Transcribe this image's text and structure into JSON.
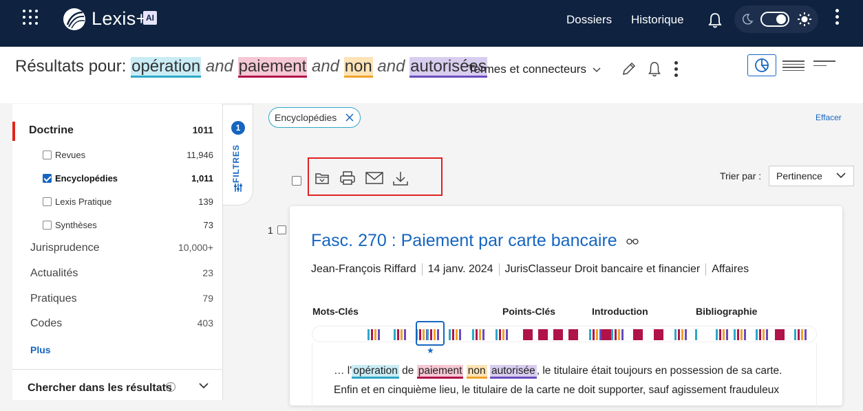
{
  "app": {
    "brand": "Lexis+",
    "ai_badge": "AI"
  },
  "topnav": {
    "dossiers": "Dossiers",
    "historique": "Historique"
  },
  "search": {
    "results_label": "Résultats pour:",
    "terms": [
      "opération",
      "paiement",
      "non",
      "autorisées"
    ],
    "connector": "and",
    "mode": "Termes et connecteurs"
  },
  "sidebar": {
    "categories": [
      {
        "label": "Doctrine",
        "count": "1011",
        "active": true
      },
      {
        "label": "Jurisprudence",
        "count": "10,000+"
      },
      {
        "label": "Actualités",
        "count": "23"
      },
      {
        "label": "Pratiques",
        "count": "79"
      },
      {
        "label": "Codes",
        "count": "403"
      }
    ],
    "subcategories": [
      {
        "label": "Revues",
        "count": "11,946",
        "checked": false
      },
      {
        "label": "Encyclopédies",
        "count": "1,011",
        "checked": true
      },
      {
        "label": "Lexis Pratique",
        "count": "139",
        "checked": false
      },
      {
        "label": "Synthèses",
        "count": "73",
        "checked": false
      }
    ],
    "more": "Plus",
    "search_within": "Chercher dans les résultats"
  },
  "filters": {
    "count": "1",
    "label": "FILTRES"
  },
  "active_filter": {
    "chip": "Encyclopédies",
    "clear": "Effacer"
  },
  "sort": {
    "label": "Trier par :",
    "value": "Pertinence"
  },
  "result": {
    "number": "1",
    "title": "Fasc. 270 : Paiement par carte bancaire",
    "author": "Jean-François Riffard",
    "date": "14 janv. 2024",
    "source": "JurisClasseur Droit bancaire et financier",
    "category": "Affaires",
    "sections": [
      "Mots-Clés",
      "Points-Clés",
      "Introduction",
      "Bibliographie"
    ],
    "snippet_line1": [
      "… l'",
      "opération",
      " de ",
      "paiement",
      " ",
      "non",
      " ",
      "autorisée",
      ", le titulaire était toujours en possession de sa carte."
    ],
    "snippet_line2": "Enfin et en cinquième lieu, le titulaire de la carte ne doit supporter, sauf agissement frauduleux"
  },
  "colors": {
    "navy": "#0f2340",
    "accent": "#1565c0",
    "red": "#e1261c"
  },
  "icons": [
    "apps-grid-icon",
    "bell-icon",
    "moon-icon",
    "sun-icon",
    "kebab-icon",
    "pencil-icon",
    "pie-chart-icon",
    "folder-icon",
    "print-icon",
    "email-icon",
    "download-icon",
    "glasses-icon",
    "close-icon",
    "chevron-down-icon",
    "info-icon"
  ]
}
